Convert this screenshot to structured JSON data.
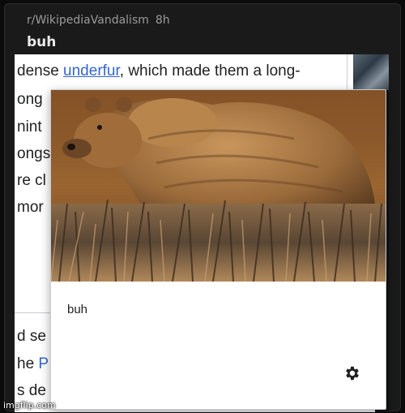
{
  "post": {
    "subreddit": "r/WikipediaVandalism",
    "age": "8h",
    "title": "buh"
  },
  "article": {
    "line1_pre": "dense ",
    "line1_link": "underfur",
    "line1_post": ", which made them a long-",
    "fragments": [
      "ong",
      "nint",
      "ongs",
      "re cl",
      "mor"
    ],
    "lower_fragments": [
      "d se",
      "he ",
      "s de"
    ],
    "lower_link": "P"
  },
  "popup": {
    "caption": "buh",
    "image_subject": "grizzly bear standing in tall dry grass"
  },
  "icons": {
    "settings": "gear-icon"
  },
  "watermark": "imgflip.com"
}
